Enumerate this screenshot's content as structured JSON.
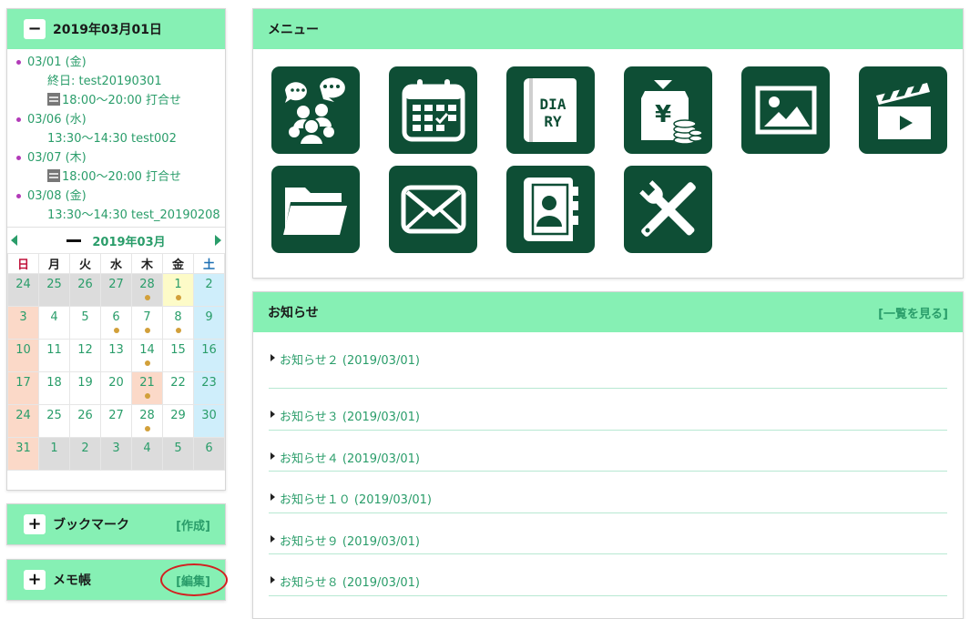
{
  "schedule": {
    "title": "2019年03月01日",
    "toggle": "−",
    "entries": [
      {
        "date": "03/01 (金)",
        "events": [
          "終日: test20190301",
          "18:00～20:00 打合せ"
        ]
      },
      {
        "date": "03/06 (水)",
        "events": [
          "13:30～14:30 test002"
        ]
      },
      {
        "date": "03/07 (木)",
        "events": [
          "18:00～20:00 打合せ"
        ]
      },
      {
        "date": "03/08 (金)",
        "events": [
          "13:30～14:30 test_20190208"
        ]
      }
    ]
  },
  "calendar": {
    "month_label": "2019年03月",
    "weekdays": [
      "日",
      "月",
      "火",
      "水",
      "木",
      "金",
      "土"
    ],
    "weeks": [
      [
        "24",
        "25",
        "26",
        "27",
        "28",
        "1",
        "2"
      ],
      [
        "3",
        "4",
        "5",
        "6",
        "7",
        "8",
        "9"
      ],
      [
        "10",
        "11",
        "12",
        "13",
        "14",
        "15",
        "16"
      ],
      [
        "17",
        "18",
        "19",
        "20",
        "21",
        "22",
        "23"
      ],
      [
        "24",
        "25",
        "26",
        "27",
        "28",
        "29",
        "30"
      ],
      [
        "31",
        "1",
        "2",
        "3",
        "4",
        "5",
        "6"
      ]
    ],
    "dots": [
      "0-4",
      "0-5",
      "1-3",
      "1-4",
      "1-5",
      "2-4",
      "3-4",
      "4-4"
    ],
    "colors": {
      "sunday": "#c0143c",
      "saturday": "#1d6fb3",
      "link": "#2a9d6a"
    }
  },
  "bookmark": {
    "title": "ブックマーク",
    "toggle": "+",
    "action": "[作成]"
  },
  "memo": {
    "title": "メモ帳",
    "toggle": "+",
    "action": "[編集]"
  },
  "menu": {
    "title": "メニュー",
    "icons": [
      "chat-bubbles-icon",
      "calendar-icon",
      "diary-icon",
      "yen-money-icon",
      "image-icon",
      "video-clapper-icon",
      "folder-icon",
      "mail-icon",
      "address-book-icon",
      "tools-icon"
    ],
    "diary_text_1": "DIA",
    "diary_text_2": "RY",
    "yen_symbol": "¥"
  },
  "news": {
    "title": "お知らせ",
    "view_all": "[一覧を見る]",
    "items": [
      "お知らせ２ (2019/03/01)",
      "お知らせ３ (2019/03/01)",
      "お知らせ４ (2019/03/01)",
      "お知らせ１０ (2019/03/01)",
      "お知らせ９ (2019/03/01)",
      "お知らせ８ (2019/03/01)"
    ]
  },
  "accent_color": "#86f0b4",
  "icon_tile_color": "#0e4e35"
}
